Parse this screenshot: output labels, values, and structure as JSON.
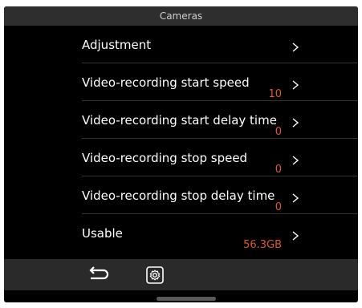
{
  "header": {
    "title": "Cameras"
  },
  "settings": {
    "items": [
      {
        "label": "Adjustment",
        "value": ""
      },
      {
        "label": "Video-recording start speed",
        "value": "10"
      },
      {
        "label": "Video-recording start delay time",
        "value": "0"
      },
      {
        "label": "Video-recording stop speed",
        "value": "0"
      },
      {
        "label": "Video-recording stop delay time",
        "value": "0"
      },
      {
        "label": "Usable",
        "value": "56.3GB"
      }
    ]
  },
  "colors": {
    "background": "#000000",
    "title_bar": "#2e2e2e",
    "value_accent": "#e0582a",
    "bottom_bar": "#2a2a2a"
  },
  "icons": {
    "row_chevron": "chevron-right-icon",
    "back": "back-arrow-icon",
    "settings": "gear-icon"
  }
}
